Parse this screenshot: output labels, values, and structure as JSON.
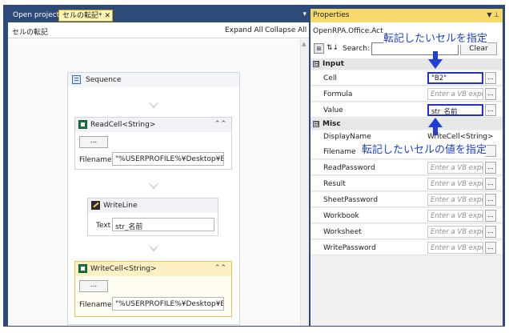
{
  "left_panel": {
    "tabs": {
      "open_project": "Open project",
      "document": "セルの転記*",
      "close": "✕",
      "dropdown": "▾"
    },
    "workflow_name": "セルの転記",
    "expand_all": "Expand All",
    "collapse_all": "Collapse All",
    "sequence_title": "Sequence",
    "read_cell": {
      "title": "ReadCell<String>",
      "chevron": "⌃⌃",
      "button": "...",
      "filename_label": "Filename",
      "filename_value": "\"%USERPROFILE%¥Desktop¥Exc"
    },
    "write_line": {
      "title": "WriteLine",
      "text_label": "Text",
      "text_value": "str_名前"
    },
    "write_cell": {
      "title": "WriteCell<String>",
      "chevron": "⌃⌃",
      "button": "...",
      "filename_label": "Filename",
      "filename_value": "\"%USERPROFILE%¥Desktop¥Exc"
    }
  },
  "properties": {
    "title": "Properties",
    "title_controls": "▼ ⊥",
    "type_name": "OpenRPA.Office.Act",
    "toolbar": {
      "categorized": "⊞",
      "alphabetical": "⇅↓",
      "search_label": "Search:",
      "search_value": "",
      "clear": "Clear"
    },
    "categories": [
      {
        "toggle": "⊟",
        "name": "Input"
      },
      {
        "toggle": "⊟",
        "name": "Misc"
      }
    ],
    "input_rows": [
      {
        "name": "Cell",
        "value": "\"B2\"",
        "placeholder": false,
        "highlight": true
      },
      {
        "name": "Formula",
        "value": "Enter a VB expr",
        "placeholder": true,
        "highlight": false
      },
      {
        "name": "Value",
        "value": "str_名前",
        "placeholder": false,
        "highlight": true
      }
    ],
    "misc_rows": [
      {
        "name": "DisplayName",
        "value": "WriteCell<String>",
        "plain": true
      },
      {
        "name": "Filename",
        "value": "",
        "plain": true
      },
      {
        "name": "ReadPassword",
        "value": "Enter a VB expr",
        "placeholder": true
      },
      {
        "name": "Result",
        "value": "Enter a VB expr",
        "placeholder": true
      },
      {
        "name": "SheetPassword",
        "value": "Enter a VB expr",
        "placeholder": true
      },
      {
        "name": "Workbook",
        "value": "Enter a VB expr",
        "placeholder": true
      },
      {
        "name": "Worksheet",
        "value": "Enter a VB expr",
        "placeholder": true
      },
      {
        "name": "WritePassword",
        "value": "Enter a VB expr",
        "placeholder": true
      }
    ],
    "button_label": "..."
  },
  "annotations": {
    "cell_note": "転記したいセルを指定",
    "value_note": "転記したいセルの値を指定",
    "color": "#1f3fd6"
  }
}
